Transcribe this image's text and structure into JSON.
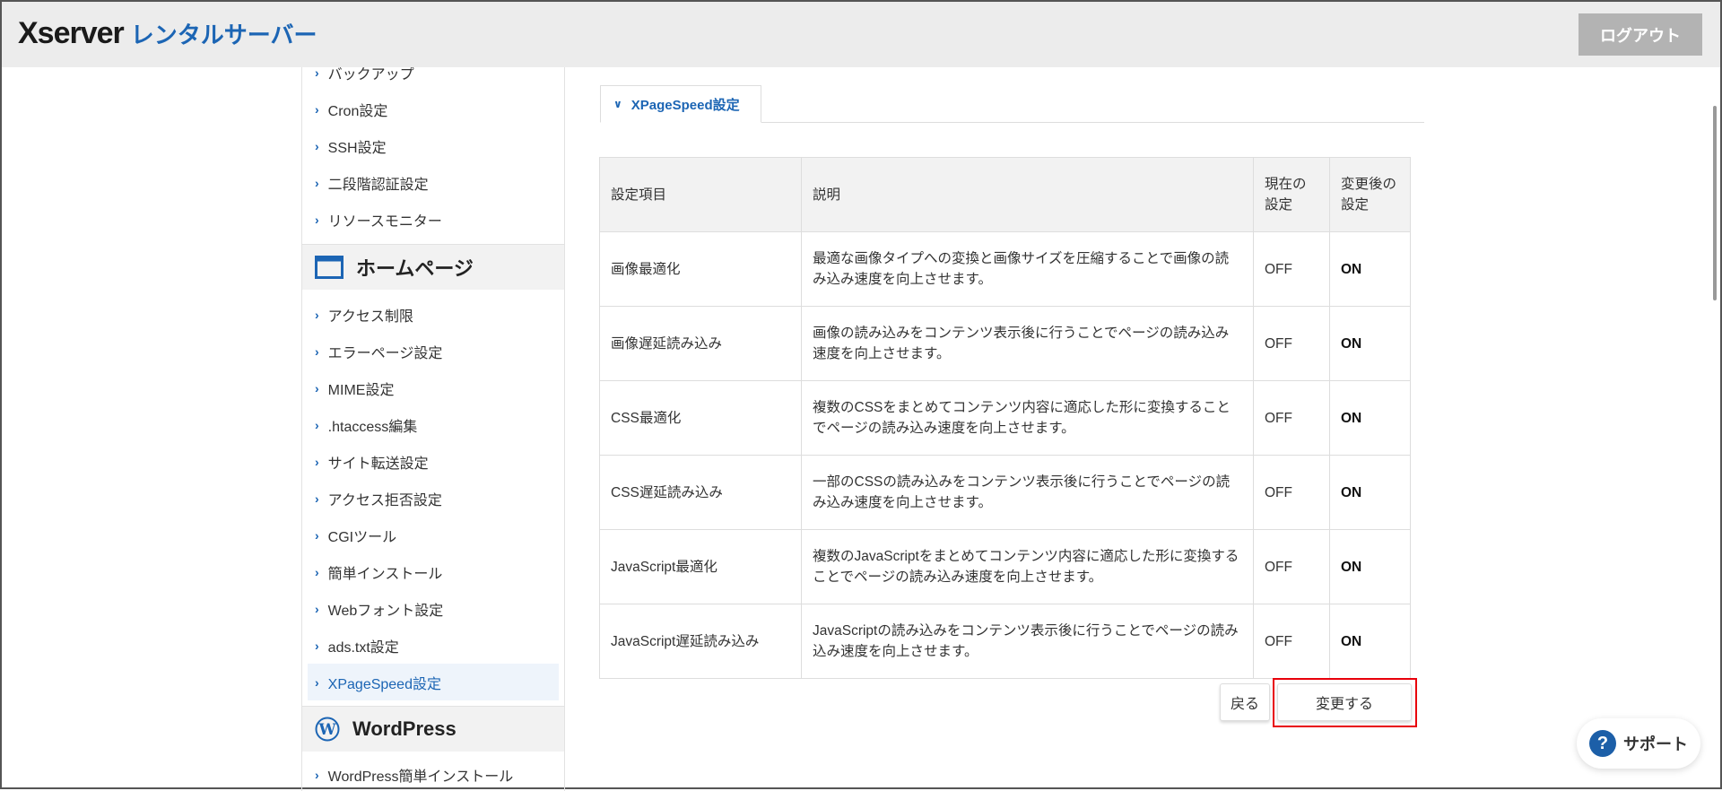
{
  "header": {
    "logo_brand": "Xserver",
    "logo_sub": "レンタルサーバー",
    "logout": "ログアウト"
  },
  "sidebar": {
    "items_top": [
      "バックアップ",
      "Cron設定",
      "SSH設定",
      "二段階認証設定",
      "リソースモニター"
    ],
    "section_homepage": "ホームページ",
    "items_homepage": [
      "アクセス制限",
      "エラーページ設定",
      "MIME設定",
      ".htaccess編集",
      "サイト転送設定",
      "アクセス拒否設定",
      "CGIツール",
      "簡単インストール",
      "Webフォント設定",
      "ads.txt設定",
      "XPageSpeed設定"
    ],
    "active_item": "XPageSpeed設定",
    "section_wordpress": "WordPress",
    "items_wordpress": [
      "WordPress簡単インストール"
    ]
  },
  "main": {
    "tab": "XPageSpeed設定",
    "table": {
      "headers": [
        "設定項目",
        "説明",
        "現在の設定",
        "変更後の設定"
      ],
      "rows": [
        [
          "画像最適化",
          "最適な画像タイプへの変換と画像サイズを圧縮することで画像の読み込み速度を向上させます。",
          "OFF",
          "ON"
        ],
        [
          "画像遅延読み込み",
          "画像の読み込みをコンテンツ表示後に行うことでページの読み込み速度を向上させます。",
          "OFF",
          "ON"
        ],
        [
          "CSS最適化",
          "複数のCSSをまとめてコンテンツ内容に適応した形に変換することでページの読み込み速度を向上させます。",
          "OFF",
          "ON"
        ],
        [
          "CSS遅延読み込み",
          "一部のCSSの読み込みをコンテンツ表示後に行うことでページの読み込み速度を向上させます。",
          "OFF",
          "ON"
        ],
        [
          "JavaScript最適化",
          "複数のJavaScriptをまとめてコンテンツ内容に適応した形に変換することでページの読み込み速度を向上させます。",
          "OFF",
          "ON"
        ],
        [
          "JavaScript遅延読み込み",
          "JavaScriptの読み込みをコンテンツ表示後に行うことでページの読み込み速度を向上させます。",
          "OFF",
          "ON"
        ]
      ]
    },
    "back": "戻る",
    "apply": "変更する"
  },
  "support": "サポート",
  "colors": {
    "brand": "#1c65b4",
    "highlight": "#e8000b"
  }
}
